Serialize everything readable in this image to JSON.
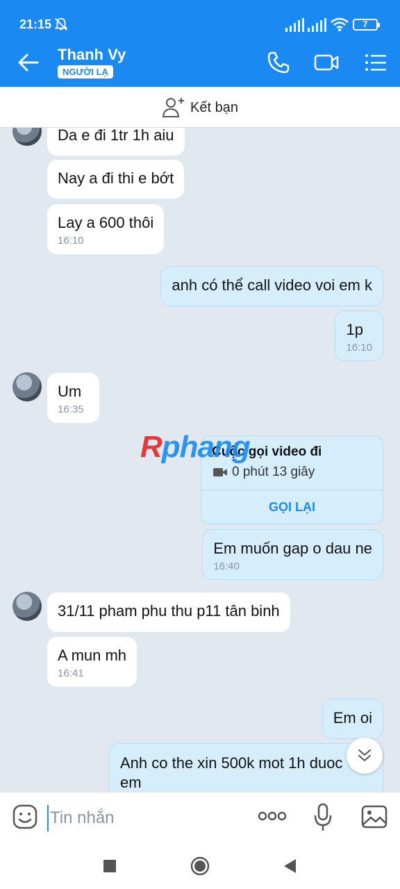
{
  "status_bar": {
    "time": "21:15",
    "battery": "7"
  },
  "header": {
    "contact_name": "Thanh Vy",
    "badge": "NGƯỜI LẠ"
  },
  "add_friend": {
    "label": "Kết bạn"
  },
  "messages": [
    {
      "dir": "in",
      "text": "Da e đi 1tr 1h aiu"
    },
    {
      "dir": "in",
      "text": "Nay a đi thi e bớt"
    },
    {
      "dir": "in",
      "text": "Lay a 600 thôi",
      "time": "16:10"
    },
    {
      "dir": "out",
      "text": "anh có thể call video voi em k"
    },
    {
      "dir": "out",
      "text": "1p",
      "time": "16:10"
    },
    {
      "dir": "in",
      "text": "Um",
      "time": "16:35"
    },
    {
      "dir": "out",
      "text": "Em muốn gap o dau ne",
      "time": "16:40"
    },
    {
      "dir": "in",
      "text": "31/11 pham phu thu p11 tân binh"
    },
    {
      "dir": "in",
      "text": "A mun mh",
      "time": "16:41"
    },
    {
      "dir": "out",
      "text": "Em oi"
    },
    {
      "dir": "out",
      "text": "Anh co the xin 500k mot 1h duoc",
      "text2": "em"
    }
  ],
  "call_card": {
    "title": "Cuộc gọi video đi",
    "duration": "0 phút 13 giây",
    "action": "GỌI LẠI"
  },
  "watermark": {
    "first": "R",
    "rest": "phang"
  },
  "composer": {
    "placeholder": "Tin nhắn"
  },
  "colors": {
    "accent": "#1a8af2",
    "outgoing_bubble": "#d6eefc",
    "background": "#e2e8f0"
  }
}
